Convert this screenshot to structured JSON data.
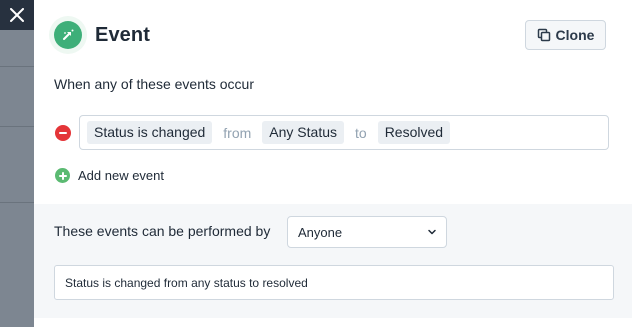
{
  "panel": {
    "title": "Event",
    "clone_label": "Clone"
  },
  "trigger": {
    "section_label": "When any of these events occur",
    "events": [
      {
        "field": "Status is changed",
        "from_word": "from",
        "from_value": "Any Status",
        "to_word": "to",
        "to_value": "Resolved"
      }
    ],
    "add_label": "Add new event"
  },
  "performer": {
    "label": "These events can be performed by",
    "selected": "Anyone",
    "summary": "Status is changed from any status to resolved"
  },
  "icons": {
    "close": "close-icon",
    "event": "event-icon",
    "clone": "copy-icon",
    "remove": "remove-icon",
    "add": "add-icon",
    "dropdown": "chevron-down-icon"
  },
  "colors": {
    "event_green": "#3eaf79",
    "remove_red": "#e43538",
    "add_green": "#5bba72",
    "close_bg": "#27313f"
  }
}
